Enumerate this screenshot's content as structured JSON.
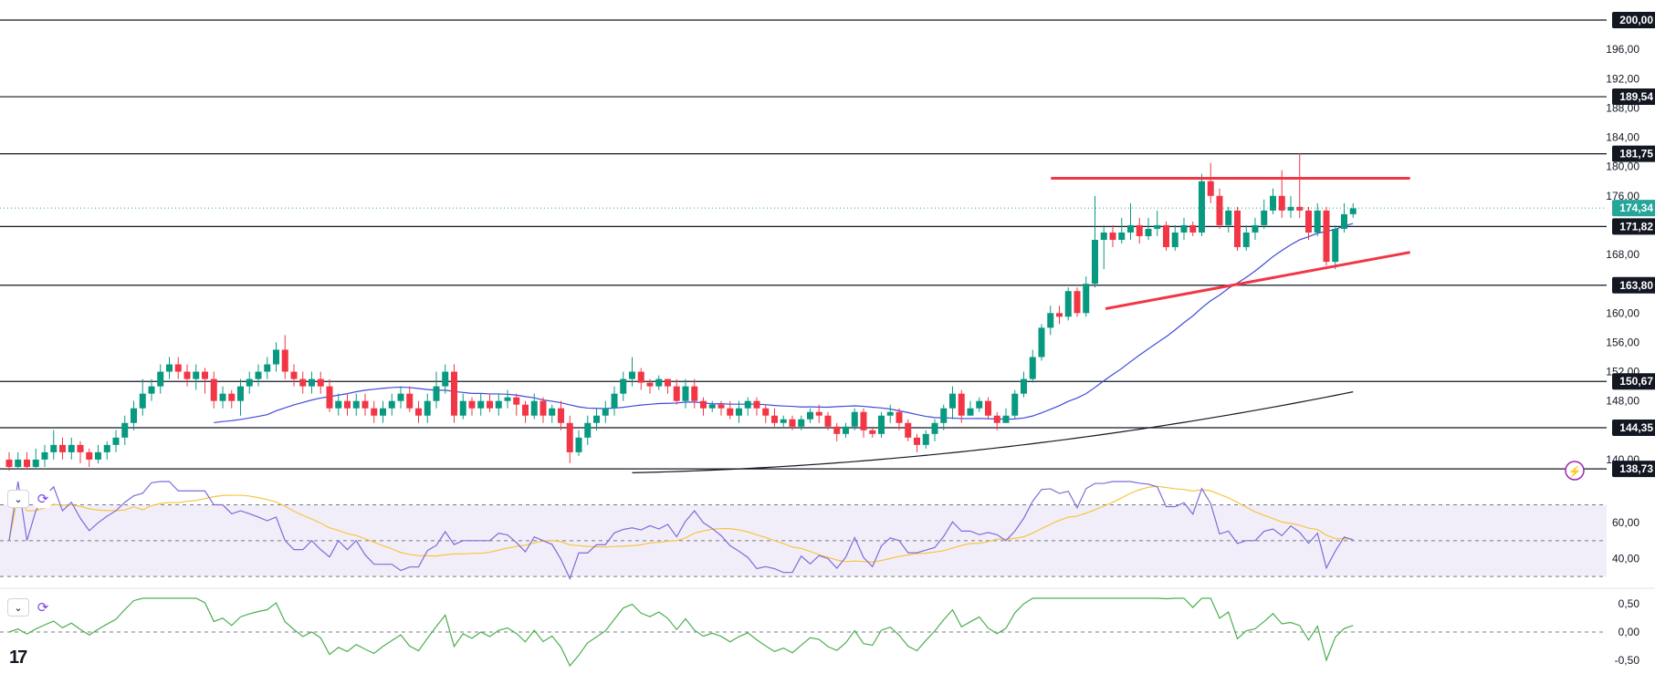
{
  "chart_data": {
    "type": "candlestick",
    "price_axis": {
      "ticks": [
        "196,00",
        "192,00",
        "188,00",
        "184,00",
        "180,00",
        "176,00",
        "168,00",
        "160,00",
        "156,00",
        "152,00",
        "148,00",
        "140,00"
      ],
      "ylim": [
        138,
        201
      ]
    },
    "horizontal_levels": [
      {
        "value": 200.0,
        "label": "200,00"
      },
      {
        "value": 189.54,
        "label": "189,54"
      },
      {
        "value": 181.75,
        "label": "181,75"
      },
      {
        "value": 171.82,
        "label": "171,82"
      },
      {
        "value": 163.8,
        "label": "163,80"
      },
      {
        "value": 150.67,
        "label": "150,67"
      },
      {
        "value": 144.35,
        "label": "144,35"
      },
      {
        "value": 138.73,
        "label": "138,73"
      }
    ],
    "last_price": {
      "value": 174.34,
      "label": "174,34",
      "color": "#26a69a"
    },
    "candles": [
      [
        140,
        139,
        141,
        138.5
      ],
      [
        139,
        140,
        141,
        138.7
      ],
      [
        140,
        139,
        141,
        138.6
      ],
      [
        139,
        140,
        141.5,
        138.7
      ],
      [
        140,
        141,
        142,
        139
      ],
      [
        141,
        142,
        144,
        140
      ],
      [
        142,
        141,
        143,
        140
      ],
      [
        141,
        142,
        143,
        140
      ],
      [
        142,
        141,
        142.5,
        139.5
      ],
      [
        141,
        140,
        141.5,
        139
      ],
      [
        140,
        141,
        142,
        139.5
      ],
      [
        141,
        142,
        142.5,
        140
      ],
      [
        142,
        143,
        144,
        141
      ],
      [
        143,
        145,
        146,
        142
      ],
      [
        145,
        147,
        148,
        144
      ],
      [
        147,
        149,
        151,
        146
      ],
      [
        149,
        150,
        151,
        148
      ],
      [
        150,
        152,
        153,
        149
      ],
      [
        152,
        153,
        154,
        151
      ],
      [
        153,
        152,
        154,
        151
      ],
      [
        152,
        151,
        153,
        150
      ],
      [
        151,
        152,
        153,
        149.5
      ],
      [
        152,
        151,
        152.5,
        149
      ],
      [
        151,
        148,
        152,
        147
      ],
      [
        148,
        149,
        150,
        147
      ],
      [
        149,
        148,
        149.5,
        147
      ],
      [
        148,
        150,
        151,
        146
      ],
      [
        150,
        151,
        152,
        149
      ],
      [
        151,
        152,
        153,
        150
      ],
      [
        152,
        153,
        154,
        151
      ],
      [
        153,
        155,
        156,
        152
      ],
      [
        155,
        152,
        157,
        151
      ],
      [
        152,
        151,
        153,
        150
      ],
      [
        151,
        150,
        152,
        149
      ],
      [
        150,
        151,
        152,
        149
      ],
      [
        151,
        150,
        152,
        149
      ],
      [
        150,
        147,
        151,
        146.5
      ],
      [
        147,
        148,
        149,
        146
      ],
      [
        148,
        147,
        149,
        146
      ],
      [
        147,
        148,
        149,
        146
      ],
      [
        148,
        147,
        149,
        146
      ],
      [
        147,
        146,
        148,
        145
      ],
      [
        146,
        147,
        148,
        145
      ],
      [
        147,
        148,
        149,
        146
      ],
      [
        148,
        149,
        150,
        147
      ],
      [
        149,
        147,
        150,
        146.5
      ],
      [
        147,
        146,
        148,
        145
      ],
      [
        146,
        148,
        149,
        145
      ],
      [
        148,
        150,
        152,
        147
      ],
      [
        150,
        152,
        153,
        149
      ],
      [
        152,
        146,
        153,
        145
      ],
      [
        146,
        148,
        149,
        145.5
      ],
      [
        148,
        147,
        148.5,
        146
      ],
      [
        147,
        148,
        149,
        146
      ],
      [
        148,
        147,
        149,
        146.5
      ],
      [
        147,
        148,
        149,
        146
      ],
      [
        148,
        148.5,
        149.5,
        147
      ],
      [
        148.5,
        147.5,
        149,
        146
      ],
      [
        147.5,
        146,
        148,
        145
      ],
      [
        146,
        148,
        149,
        145.5
      ],
      [
        148,
        146,
        148.5,
        145
      ],
      [
        146,
        147,
        147.5,
        145
      ],
      [
        147,
        145,
        148,
        144
      ],
      [
        145,
        141,
        146,
        139.5
      ],
      [
        141,
        143,
        144,
        140.5
      ],
      [
        143,
        145,
        146,
        142
      ],
      [
        145,
        146,
        147,
        144
      ],
      [
        146,
        147,
        148,
        145
      ],
      [
        147,
        149,
        150,
        146
      ],
      [
        149,
        151,
        152,
        148
      ],
      [
        151,
        152,
        154,
        150
      ],
      [
        152,
        150.5,
        152.5,
        149.5
      ],
      [
        150.5,
        150,
        151,
        149
      ],
      [
        150,
        151,
        151.5,
        149.5
      ],
      [
        151,
        150,
        151,
        149
      ],
      [
        150,
        148,
        151,
        147.5
      ],
      [
        148,
        150,
        151,
        147
      ],
      [
        150,
        148,
        151,
        147
      ],
      [
        148,
        147,
        148.5,
        146
      ],
      [
        147,
        147.5,
        148,
        146.5
      ],
      [
        147.5,
        147,
        148,
        146
      ],
      [
        147,
        146,
        148,
        145.5
      ],
      [
        146,
        147,
        148,
        145
      ],
      [
        147,
        148,
        148.5,
        146
      ],
      [
        148,
        147,
        148.5,
        146
      ],
      [
        147,
        146,
        147.5,
        145
      ],
      [
        146,
        145,
        147,
        144.5
      ],
      [
        145,
        145.5,
        146,
        144.5
      ],
      [
        145.5,
        144.5,
        146,
        144
      ],
      [
        144.5,
        145.5,
        146,
        144
      ],
      [
        145.5,
        146.5,
        147,
        145
      ],
      [
        146.5,
        146,
        147.5,
        145
      ],
      [
        146,
        144.5,
        146.5,
        144
      ],
      [
        144.5,
        143.5,
        145,
        142.5
      ],
      [
        143.5,
        144.5,
        145,
        143
      ],
      [
        144.5,
        146.5,
        147,
        144
      ],
      [
        146.5,
        144,
        147,
        143
      ],
      [
        144,
        143.5,
        144.5,
        143
      ],
      [
        143.5,
        146,
        146.5,
        143
      ],
      [
        146,
        146.5,
        147.5,
        145
      ],
      [
        146.5,
        145,
        147,
        144
      ],
      [
        145,
        143,
        145.5,
        142.5
      ],
      [
        143,
        142,
        143.5,
        141
      ],
      [
        142,
        143.5,
        144,
        141.5
      ],
      [
        143.5,
        145,
        145.5,
        142.5
      ],
      [
        145,
        147,
        147.5,
        144
      ],
      [
        147,
        149,
        150,
        145.5
      ],
      [
        149,
        146,
        149.5,
        145
      ],
      [
        146,
        147,
        148,
        146
      ],
      [
        147,
        148,
        148.5,
        146.5
      ],
      [
        148,
        146,
        148.5,
        145.5
      ],
      [
        146,
        145,
        146.5,
        144
      ],
      [
        145,
        146,
        147,
        145
      ],
      [
        146,
        149,
        149.5,
        145.5
      ],
      [
        149,
        151,
        152,
        148.5
      ],
      [
        151,
        154,
        155,
        150.5
      ],
      [
        154,
        158,
        158.5,
        153.5
      ],
      [
        158,
        160,
        161,
        157
      ],
      [
        160,
        159.5,
        161,
        158.5
      ],
      [
        159.5,
        163,
        163.5,
        159
      ],
      [
        163,
        160,
        163.5,
        159.5
      ],
      [
        160,
        164,
        165,
        159.5
      ],
      [
        164,
        170,
        176,
        163.5
      ],
      [
        170,
        171,
        172,
        166
      ],
      [
        171,
        170,
        172,
        169
      ],
      [
        170,
        171,
        173,
        169.5
      ],
      [
        171,
        172,
        175,
        170
      ],
      [
        172,
        170.5,
        173,
        169.5
      ],
      [
        170.5,
        171.5,
        173,
        170
      ],
      [
        171.5,
        172,
        174,
        170.5
      ],
      [
        172,
        169,
        172.5,
        168.5
      ],
      [
        169,
        171,
        172,
        168.5
      ],
      [
        171,
        172,
        173,
        170
      ],
      [
        172,
        171,
        172.5,
        170.5
      ],
      [
        171,
        178,
        179,
        170.5
      ],
      [
        178,
        176,
        180.5,
        175
      ],
      [
        176,
        172,
        177,
        171.5
      ],
      [
        172,
        174,
        174.5,
        171
      ],
      [
        174,
        169,
        174.5,
        168.5
      ],
      [
        169,
        171,
        172,
        168.5
      ],
      [
        171,
        172,
        173,
        170
      ],
      [
        172,
        174,
        175.5,
        171.5
      ],
      [
        174,
        176,
        177,
        173.5
      ],
      [
        176,
        174,
        179.5,
        173
      ],
      [
        174,
        174.5,
        176,
        173
      ],
      [
        174.5,
        174,
        181.8,
        173
      ],
      [
        174,
        171,
        174.5,
        170
      ],
      [
        171,
        174,
        175,
        170.5
      ],
      [
        174,
        167,
        174.5,
        166.5
      ],
      [
        167,
        171.5,
        172,
        166
      ],
      [
        171.5,
        173.5,
        175,
        171
      ],
      [
        173.5,
        174.3,
        175,
        173
      ]
    ],
    "trendlines": [
      {
        "name": "resistance",
        "color": "#f23645",
        "points": [
          [
            0.635,
            178.4
          ],
          [
            0.852,
            178.4
          ]
        ]
      },
      {
        "name": "support",
        "color": "#f23645",
        "points": [
          [
            0.668,
            160.6
          ],
          [
            0.852,
            168.3
          ]
        ]
      }
    ],
    "rsi": {
      "ticks": [
        "60,00",
        "40,00"
      ],
      "ylim": [
        27,
        83
      ],
      "band": [
        30,
        70
      ],
      "mid": 50,
      "line_color": "#7e6cd8",
      "ma_color": "#f5c542"
    },
    "macd_hist": {
      "ticks": [
        "0,50",
        "0,00",
        "-0,50"
      ],
      "ylim": [
        -0.6,
        0.6
      ],
      "line_color": "#4caf50"
    }
  },
  "ui": {
    "collapse_glyph": "⌄",
    "sync_glyph": "⟳",
    "replay_glyph": "⚡",
    "logo": "17"
  }
}
